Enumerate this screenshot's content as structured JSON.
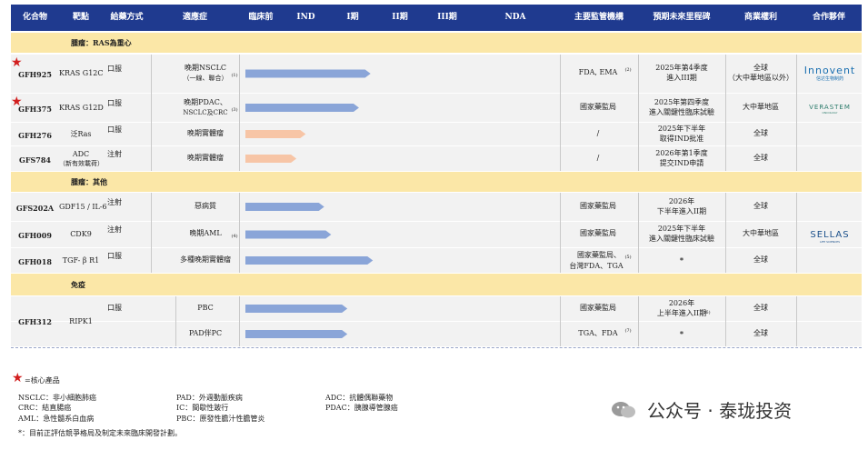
{
  "colors": {
    "header_bg": "#1f3a8f",
    "section_bg": "#fbe7a7",
    "bar_blue": "#8aa5d8",
    "bar_peach": "#f7c5a6",
    "star": "#d21e1e",
    "innovent": "#1a6fb0",
    "verastem": "#2a7a6a"
  },
  "headers": [
    "化合物",
    "靶點",
    "給藥方式",
    "適應症",
    "臨床前",
    "IND",
    "I期",
    "II期",
    "III期",
    "NDA",
    "主要監管機構",
    "預期未來里程碑",
    "商業權利",
    "合作夥伴"
  ],
  "sections": {
    "s1": "腫瘤：RAS為重心",
    "s2": "腫瘤：其他",
    "s3": "免疫"
  },
  "rows": [
    {
      "compound": "GFH925",
      "target": "KRAS G12C",
      "route": "口服",
      "indication_l1": "晚期NSCLC",
      "indication_l2": "（一線、聯合）",
      "indication_sup": "(1)",
      "regulator": "FDA, EMA",
      "regulator_sup": "(2)",
      "milestone_l1": "2025年第4季度",
      "milestone_l2": "進入III期",
      "rights_l1": "全球",
      "rights_l2": "（大中華地區以外）",
      "partner": "Innovent",
      "partner_sub": "信达生物制药",
      "core": true
    },
    {
      "compound": "GFH375",
      "target": "KRAS G12D",
      "route": "口服",
      "indication_l1": "晚期PDAC、",
      "indication_l2": "NSCLC及CRC",
      "indication_sup": "(3)",
      "regulator": "國家藥監局",
      "regulator_sup": "",
      "milestone_l1": "2025年第四季度",
      "milestone_l2": "進入關鍵性臨床試驗",
      "rights_l1": "大中華地區",
      "rights_l2": "",
      "partner": "VERASTEM",
      "partner_sub": "ONCOLOGY",
      "core": true
    },
    {
      "compound": "GFH276",
      "target": "泛Ras",
      "route": "口服",
      "indication_l1": "晚期實體瘤",
      "indication_l2": "",
      "indication_sup": "",
      "regulator": "/",
      "regulator_sup": "",
      "milestone_l1": "2025年下半年",
      "milestone_l2": "取得IND批准",
      "rights_l1": "全球",
      "rights_l2": "",
      "partner": "",
      "partner_sub": "",
      "core": false
    },
    {
      "compound": "GFS784",
      "target": "ADC",
      "target_l2": "（新有效載荷）",
      "route": "注射",
      "indication_l1": "晚期實體瘤",
      "indication_l2": "",
      "indication_sup": "",
      "regulator": "/",
      "regulator_sup": "",
      "milestone_l1": "2026年第1季度",
      "milestone_l2": "提交IND申請",
      "rights_l1": "全球",
      "rights_l2": "",
      "partner": "",
      "partner_sub": "",
      "core": false
    },
    {
      "compound": "GFS202A",
      "target": "GDF15 / IL-6",
      "route": "注射",
      "indication_l1": "惡病質",
      "indication_l2": "",
      "indication_sup": "",
      "regulator": "國家藥監局",
      "regulator_sup": "",
      "milestone_l1": "2026年",
      "milestone_l2": "下半年進入II期",
      "rights_l1": "全球",
      "rights_l2": "",
      "partner": "",
      "partner_sub": "",
      "core": false
    },
    {
      "compound": "GFH009",
      "target": "CDK9",
      "route": "注射",
      "indication_l1": "晚期AML",
      "indication_l2": "",
      "indication_sup": "(4)",
      "regulator": "國家藥監局",
      "regulator_sup": "",
      "milestone_l1": "2025年下半年",
      "milestone_l2": "進入關鍵性臨床試驗",
      "rights_l1": "大中華地區",
      "rights_l2": "",
      "partner": "SELLAS",
      "partner_sub": "LIFE SCIENCES",
      "core": false
    },
    {
      "compound": "GFH018",
      "target": "TGF- β R1",
      "route": "口服",
      "indication_l1": "多種晚期實體瘤",
      "indication_l2": "",
      "indication_sup": "",
      "regulator": "國家藥監局、",
      "regulator_l2": "台灣FDA、TGA",
      "regulator_sup": "(5)",
      "milestone_l1": "*",
      "milestone_l2": "",
      "rights_l1": "全球",
      "rights_l2": "",
      "partner": "",
      "partner_sub": "",
      "core": false
    },
    {
      "compound": "GFH312",
      "target": "RIPK1",
      "route": "口服",
      "indication_l1": "PBC",
      "indication_l2": "",
      "indication_sup": "",
      "regulator": "國家藥監局",
      "regulator_sup": "",
      "milestone_l1": "2026年",
      "milestone_l2": "上半年進入II期",
      "milestone_sup": "(6)",
      "rights_l1": "全球",
      "rights_l2": "",
      "partner": "",
      "partner_sub": "",
      "core": false
    },
    {
      "compound": "",
      "target": "",
      "route": "",
      "indication_l1": "PAD伴PC",
      "indication_l2": "",
      "indication_sup": "",
      "regulator": "TGA、FDA",
      "regulator_sup": "(7)",
      "milestone_l1": "*",
      "milestone_l2": "",
      "rights_l1": "全球",
      "rights_l2": "",
      "partner": "",
      "partner_sub": "",
      "core": false
    }
  ],
  "chart_data": {
    "type": "bar",
    "title": "",
    "stages": [
      "臨床前",
      "IND",
      "I期",
      "II期",
      "III期",
      "NDA"
    ],
    "series": [
      {
        "name": "",
        "values": [
          2.7,
          2.45,
          1.3,
          1.1,
          1.7,
          1.85,
          2.75,
          2.2,
          2.2
        ]
      }
    ],
    "categories": [
      "GFH925",
      "GFH375",
      "GFH276",
      "GFS784",
      "GFS202A",
      "GFH009",
      "GFH018",
      "GFH312 PBC",
      "GFH312 PAD伴PC"
    ],
    "bar_colors": [
      "blue",
      "blue",
      "peach",
      "peach",
      "blue",
      "blue",
      "blue",
      "blue",
      "blue"
    ],
    "value_unit": "stage",
    "xlim": [
      0,
      6
    ]
  },
  "legend": {
    "core_label": "=核心產品",
    "items": [
      "NSCLC：非小細胞肺癌",
      "CRC：結直腸癌",
      "AML：急性髓系白血病",
      "PAD：外週動脈疾病",
      "IC：間歇性跛行",
      "PBC：原發性膽汁性膽管炎",
      "ADC：抗體偶聯藥物",
      "PDAC：胰腺導管腺癌"
    ],
    "footnote": "*：目前正評估競爭格局及制定未來臨床開發計劃。"
  },
  "watermark": "公众号 · 泰珑投资"
}
